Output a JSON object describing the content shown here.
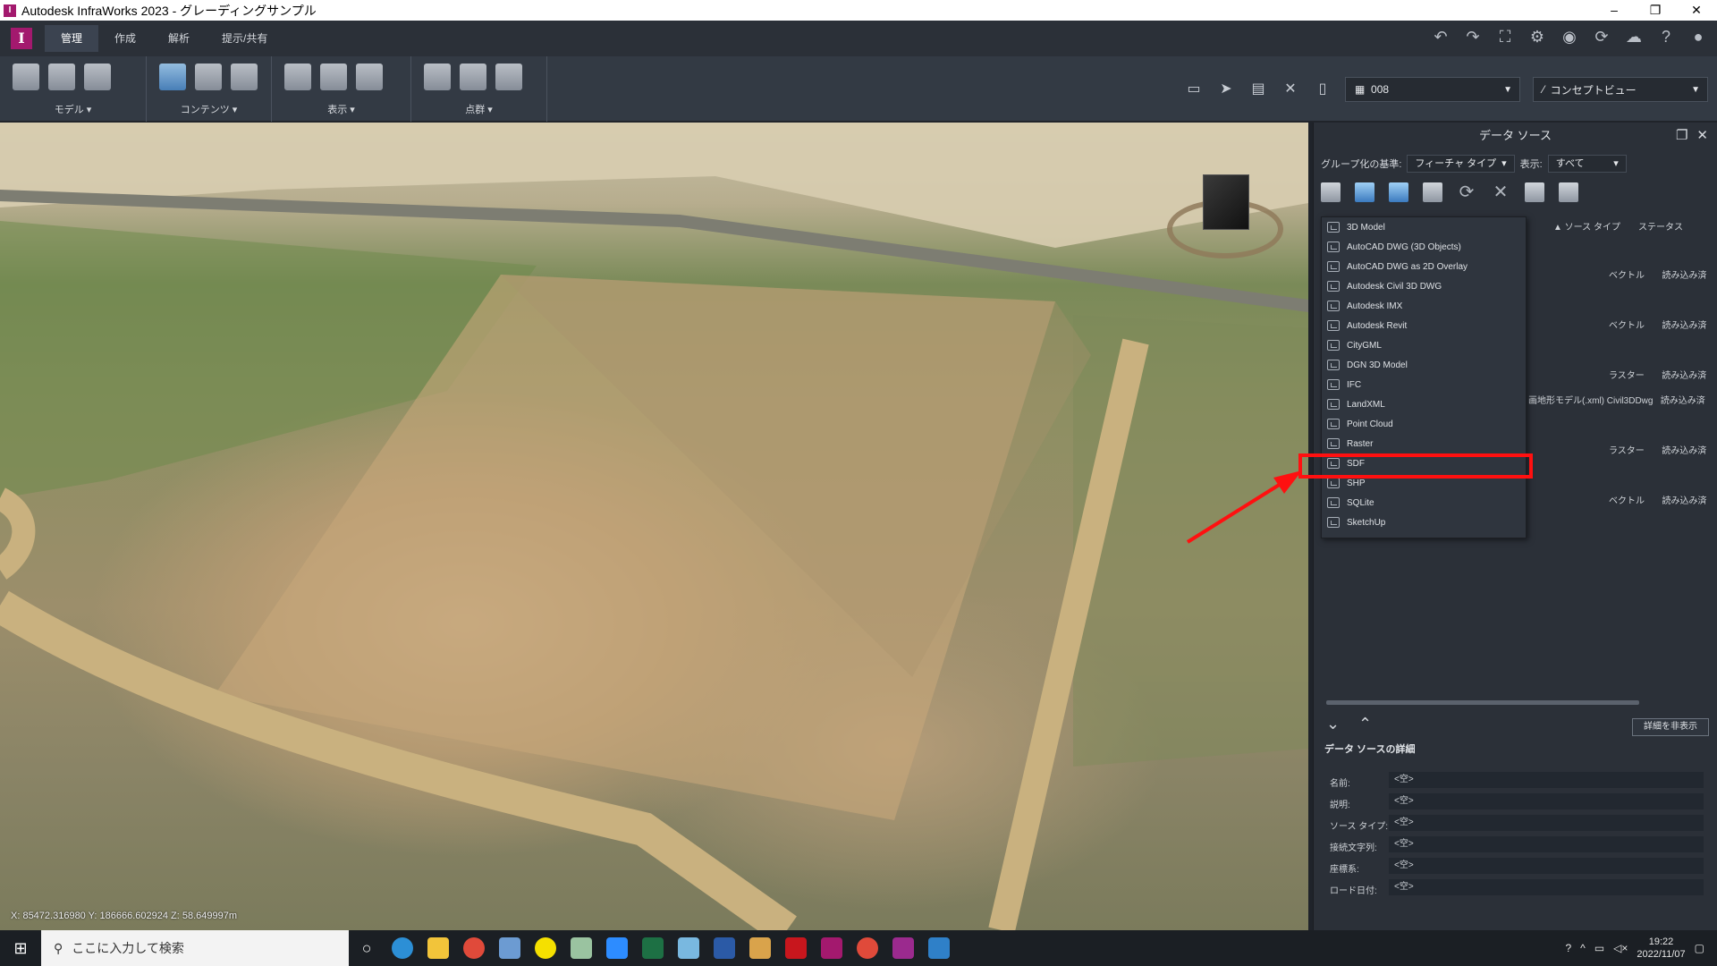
{
  "window": {
    "title": "Autodesk InfraWorks 2023 - グレーディングサンプル",
    "app_icon": "I",
    "min": "–",
    "restore": "❐",
    "close": "✕"
  },
  "ribbon": {
    "logo": "I",
    "tabs": [
      "管理",
      "作成",
      "解析",
      "提示/共有"
    ],
    "active_tab": "管理",
    "groups": [
      {
        "label": "モデル ▾"
      },
      {
        "label": "コンテンツ ▾"
      },
      {
        "label": "表示 ▾"
      },
      {
        "label": "点群 ▾"
      }
    ],
    "proposal_combo": "008",
    "view_combo": "コンセプトビュー"
  },
  "viewport": {
    "coords": "X: 85472.316980 Y: 186666.602924 Z: 58.649997m"
  },
  "panel": {
    "title": "データ ソース",
    "group_by_label": "グループ化の基準:",
    "group_by_value": "フィーチャ タイプ",
    "display_label": "表示:",
    "display_value": "すべて",
    "col_source_type": "▲ ソース タイプ",
    "col_status": "ステータス",
    "rows": [
      {
        "type": "ベクトル",
        "status": "読み込み済"
      },
      {
        "type": "ベクトル",
        "status": "読み込み済"
      },
      {
        "type": "ラスター",
        "status": "読み込み済"
      },
      {
        "name": "画地形モデル(.xml)",
        "type": "Civil3DDwg",
        "status": "読み込み済"
      },
      {
        "type": "ラスター",
        "status": "読み込み済"
      },
      {
        "type": "ベクトル",
        "status": "読み込み済"
      }
    ],
    "hide_details_button": "詳細を非表示",
    "details_title": "データ ソースの詳細",
    "details": [
      {
        "key": "名前:",
        "value": "<空>"
      },
      {
        "key": "説明:",
        "value": "<空>"
      },
      {
        "key": "ソース タイプ:",
        "value": "<空>"
      },
      {
        "key": "接続文字列:",
        "value": "<空>"
      },
      {
        "key": "座標系:",
        "value": "<空>"
      },
      {
        "key": "ロード日付:",
        "value": "<空>"
      }
    ]
  },
  "datasource_menu": {
    "items": [
      "3D Model",
      "AutoCAD DWG (3D Objects)",
      "AutoCAD DWG as 2D Overlay",
      "Autodesk Civil 3D DWG",
      "Autodesk IMX",
      "Autodesk Revit",
      "CityGML",
      "DGN 3D Model",
      "IFC",
      "LandXML",
      "Point Cloud",
      "Raster",
      "SDF",
      "SHP",
      "SQLite",
      "SketchUp"
    ],
    "highlighted": "SDF"
  },
  "taskbar": {
    "search_placeholder": "ここに入力して検索",
    "time": "19:22",
    "date": "2022/11/07"
  },
  "colors": {
    "accent": "#a3196e",
    "highlight": "#ff1010",
    "panel": "#2b3038"
  }
}
